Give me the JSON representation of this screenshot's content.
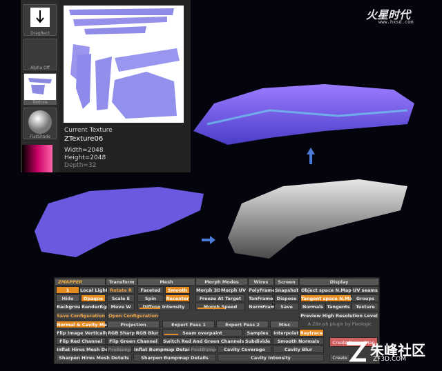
{
  "texture_panel": {
    "thumbs": [
      "DragRect",
      "Alpha Off",
      "Texture",
      "FlatShade"
    ],
    "current_label": "Current Texture",
    "name": "ZTexture06",
    "width": "Width=2048",
    "height": "Height=2048",
    "depth": "Depth=32"
  },
  "logo": {
    "text": "火星时代",
    "url": "www.hxsd.com"
  },
  "watermark": {
    "text": "朱峰社区",
    "url": "ZF3D.COM"
  },
  "zmapper": {
    "title": "ZMAPPER",
    "menu": [
      "Transform",
      "Mesh",
      "Morph Modes",
      "Wires",
      "Screen",
      "Display"
    ],
    "row1": [
      "1",
      "Local Light",
      "Rotate R",
      "Faceted",
      "Smooth",
      "Morph 3D",
      "Morph UV",
      "PolyFrame",
      "Snapshot",
      "Object space N.Map",
      "UV seams"
    ],
    "row2": [
      "Hide",
      "Opaque",
      "Scale E",
      "Spin",
      "Recenter",
      "Freeze At Target",
      "TanFrame",
      "Dispose",
      "Tangent space N.Map",
      "Groups"
    ],
    "row3": [
      "Background",
      "RenderRgn",
      "Move W",
      "Diffuse Intensity",
      "Morph Speed",
      "NormFrame",
      "Save",
      "Normals",
      "Tangents",
      "Texture"
    ],
    "row4": [
      "Save Configuration",
      "Open Configuration",
      "Preview High Resolution Level"
    ],
    "tabs": [
      "Normal & Cavity Map",
      "Projection",
      "Expert Pass 1",
      "Expert Pass 2",
      "Misc",
      "A ZBrush plugin by Pixologic"
    ],
    "row5": [
      "Flip Image Vertically",
      "RGB Sharp",
      "RGB Blur",
      "Seam overpaint",
      "Samples",
      "Interpolate",
      "Raytrace"
    ],
    "row6": [
      "Flip Red Channel",
      "Flip Green Channel",
      "Switch Red And Green Channels",
      "Subdivide",
      "Smooth Normals"
    ],
    "row7": [
      "Inflat Hires Mesh Details",
      "ProBump",
      "Inflat Bumpmap Details",
      "PostBump",
      "Cavity Coverage",
      "Cavity Blur"
    ],
    "row8": [
      "Sharpen Hires Mesh Details",
      "Sharpen Bumpmap Details",
      "Cavity Intensity"
    ],
    "create_label": "Create NormalMap",
    "create2_label": "Create"
  }
}
